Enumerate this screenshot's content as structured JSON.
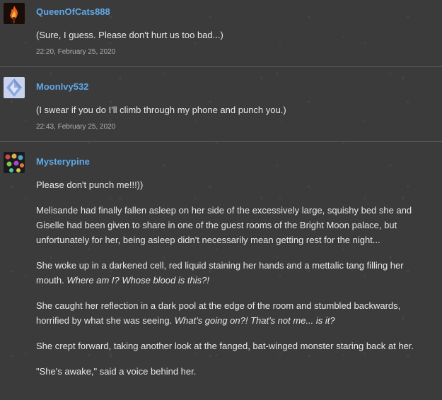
{
  "comments": [
    {
      "username": "QueenOfCats888",
      "avatar_icon": "fire-avatar-icon",
      "paragraphs": [
        "(Sure, I guess. Please don't hurt us too bad...)"
      ],
      "timestamp": "22:20, February 25, 2020"
    },
    {
      "username": "MoonIvy532",
      "avatar_icon": "crystal-avatar-icon",
      "paragraphs": [
        "(I swear if you do I'll climb through my phone and punch you.)"
      ],
      "timestamp": "22:43, February 25, 2020"
    },
    {
      "username": "Mysterypine",
      "avatar_icon": "gems-avatar-icon",
      "paragraphs": [
        "Please don't punch me!!!))",
        "Melisande had finally fallen asleep on her side of the excessively large, squishy bed she and Giselle had been given to share in one of the guest rooms of the Bright Moon palace, but unfortunately for her, being asleep didn't necessarily mean getting rest for the night...",
        {
          "text": "She woke up in a darkened cell, red liquid staining her hands and a mettalic tang filling her mouth. ",
          "em": "Where am I? Whose blood is this?!"
        },
        {
          "text": "She caught her reflection in a dark pool at the edge of the room and stumbled backwards, horrified by what she was seeing. ",
          "em": "What's going on?! That's not me... is it?"
        },
        "She crept forward, taking another look at the fanged, bat-winged monster staring back at her.",
        "\"She's awake,\" said a voice behind her."
      ]
    }
  ],
  "colors": {
    "background": "#3b3b3b",
    "username": "#5fa8e8",
    "text": "#e8e8e8",
    "timestamp": "#b0b0b0",
    "divider": "#5c5c5c"
  }
}
